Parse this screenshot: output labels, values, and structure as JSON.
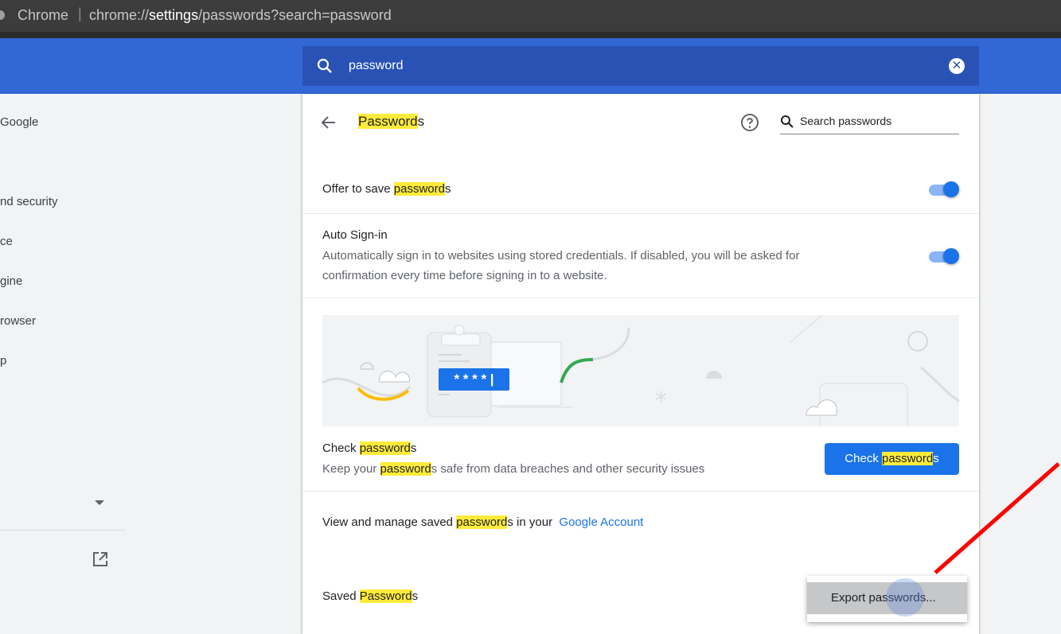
{
  "browser": {
    "app_name": "Chrome",
    "url_prefix": "chrome://",
    "url_host": "settings",
    "url_path": "/passwords?search=password"
  },
  "header": {
    "search_value": "password",
    "search_icon": "search-icon",
    "clear_icon": "clear-icon"
  },
  "sidebar": {
    "items": [
      {
        "label": "Google"
      },
      {
        "label": "nd security"
      },
      {
        "label": "ce"
      },
      {
        "label": "gine"
      },
      {
        "label": "rowser"
      },
      {
        "label": "p"
      }
    ],
    "expand_icon": "caret-down-icon",
    "external_icon": "open-in-new-icon"
  },
  "passwords_page": {
    "title_highlight": "Password",
    "title_rest": "s",
    "search_placeholder": "Search passwords",
    "offer_save": {
      "prefix": "Offer to save ",
      "highlight": "password",
      "suffix": "s",
      "enabled": true
    },
    "auto_signin": {
      "label": "Auto Sign-in",
      "description_line1": "Automatically sign in to websites using stored credentials. If disabled, you will be asked for",
      "description_line2": "confirmation every time before signing in to a website.",
      "enabled": true
    },
    "illustration": {
      "masked_text": "* * * * |"
    },
    "check": {
      "title_prefix": "Check ",
      "title_highlight": "password",
      "title_suffix": "s",
      "sub_prefix": "Keep your ",
      "sub_highlight": "password",
      "sub_suffix": "s safe from data breaches and other security issues",
      "button_prefix": "Check ",
      "button_highlight": "password",
      "button_suffix": "s"
    },
    "manage": {
      "prefix": "View and manage saved ",
      "highlight": "password",
      "suffix": "s in your",
      "link": "Google Account"
    },
    "saved": {
      "prefix": "Saved ",
      "highlight": "Password",
      "suffix": "s"
    }
  },
  "menu": {
    "export_label": "Export passwords..."
  },
  "colors": {
    "header_blue": "#3367d6",
    "accent": "#1a73e8",
    "highlight": "#ffeb3b",
    "annotation": "#ff0000"
  }
}
